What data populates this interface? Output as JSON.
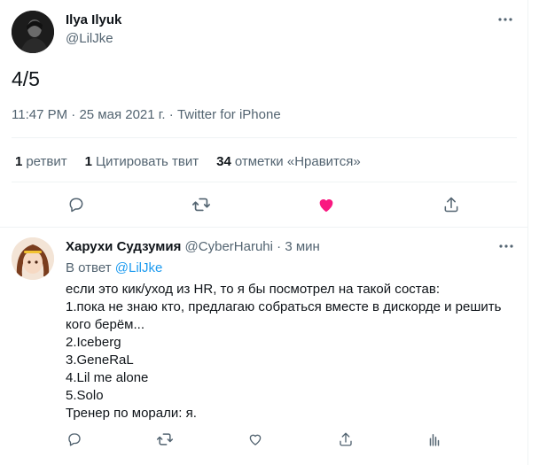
{
  "tweet": {
    "author_name": "Ilya Ilyuk",
    "author_handle": "@LilJke",
    "text": "4/5",
    "time": "11:47 PM",
    "dot": "·",
    "date": "25 мая 2021 г.",
    "source": "Twitter for iPhone",
    "stats": {
      "retweets_count": "1",
      "retweets_label": "ретвит",
      "quotes_count": "1",
      "quotes_label": "Цитировать твит",
      "likes_count": "34",
      "likes_label": "отметки «Нравится»"
    },
    "liked": true
  },
  "reply": {
    "author_name": "Харухи Судзумия",
    "author_handle": "@CyberHaruhi",
    "dot": "·",
    "time_ago": "3 мин",
    "reply_to_prefix": "В ответ",
    "reply_to_handle": "@LilJke",
    "lines": [
      "если это кик/уход из HR, то я бы посмотрел на такой состав:",
      "1.пока не знаю кто, предлагаю собраться вместе в дискорде и решить кого берём...",
      "2.Iceberg",
      "3.GeneRaL",
      "4.Lil me alone",
      "5.Solo",
      "Тренер по морали: я."
    ]
  },
  "colors": {
    "text_primary": "#0f1419",
    "text_secondary": "#536471",
    "link": "#1d9bf0",
    "like_active": "#f91880",
    "divider": "#eff3f4"
  },
  "icons": {
    "main_actions": [
      "reply-icon",
      "retweet-icon",
      "like-icon",
      "share-icon"
    ],
    "reply_actions": [
      "reply-icon",
      "retweet-icon",
      "like-icon",
      "share-icon",
      "analytics-icon"
    ],
    "menu": "more-icon"
  }
}
